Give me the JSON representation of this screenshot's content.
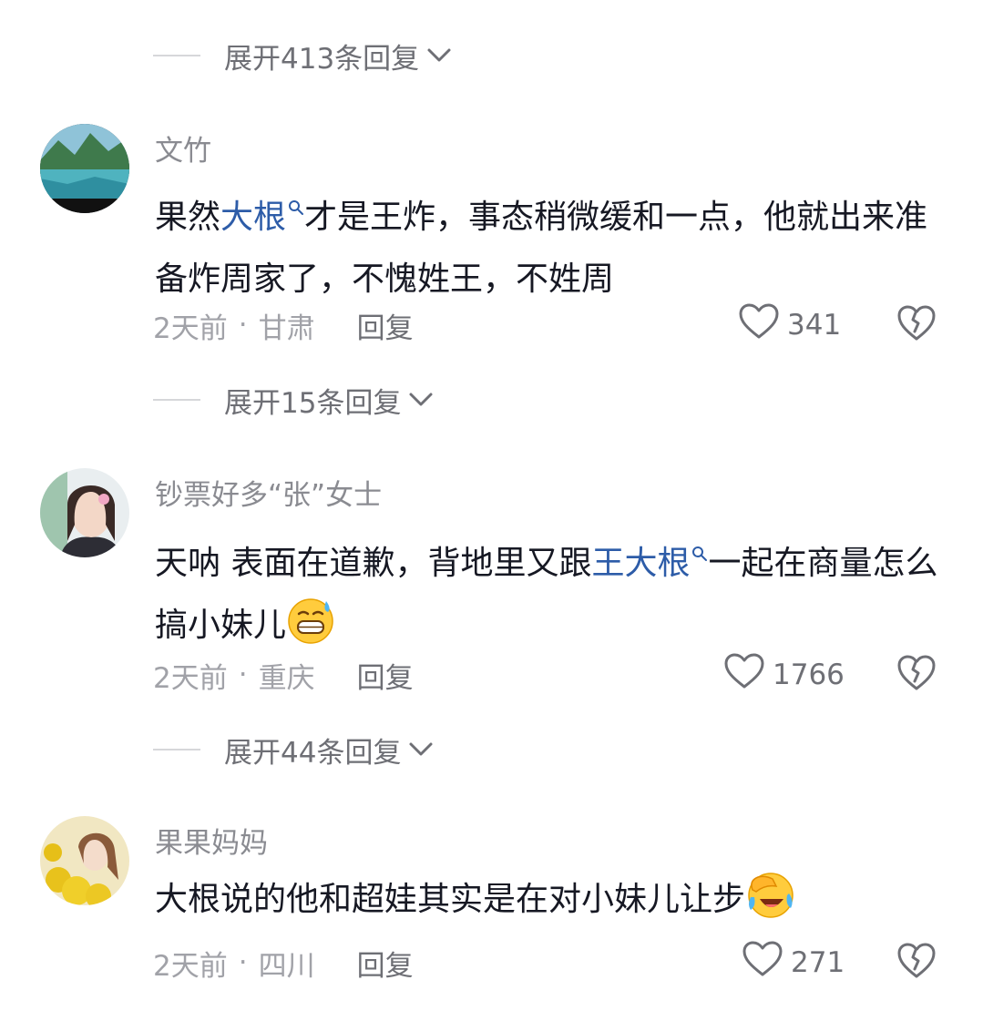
{
  "comments": [
    {
      "expand_before": "展开413条回复",
      "username": "文竹",
      "text_parts": [
        "果然",
        "大根",
        "才是王炸，事态稍微缓和一点，他就出来准备炸周家了，不愧姓王，不姓周"
      ],
      "time": "2天前",
      "location": "甘肃",
      "reply_label": "回复",
      "likes": "341",
      "expand_after": "展开15条回复"
    },
    {
      "username": "钞票好多“张”女士",
      "text_parts": [
        "天呐 表面在道歉，背地里又跟",
        "王大根",
        "一起在商量怎么搞小妹儿"
      ],
      "emoji": "grimace-sweat-emoji",
      "time": "2天前",
      "location": "重庆",
      "reply_label": "回复",
      "likes": "1766",
      "expand_after": "展开44条回复"
    },
    {
      "username": "果果妈妈",
      "text": "大根说的他和超娃其实是在对小妹儿让步",
      "emoji": "facepalm-cry-emoji",
      "time": "2天前",
      "location": "四川",
      "reply_label": "回复",
      "likes": "271"
    }
  ],
  "colors": {
    "link": "#2d5ca8",
    "text": "#161823",
    "meta": "#a1a2a8"
  }
}
